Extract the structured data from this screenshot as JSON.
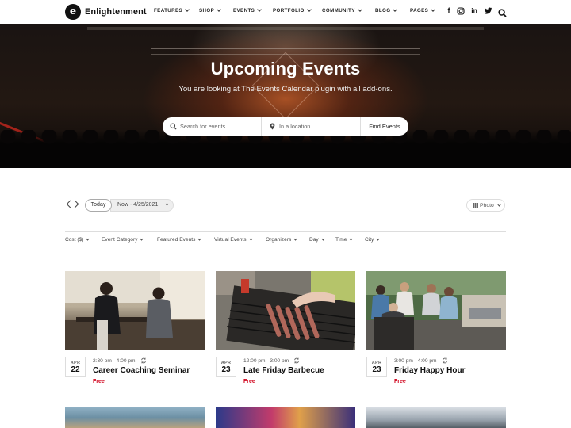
{
  "header": {
    "logo_letter": "e",
    "logo_text": "Enlightenment",
    "nav": [
      "FEATURES",
      "SHOP",
      "EVENTS",
      "PORTFOLIO",
      "COMMUNITY",
      "BLOG",
      "PAGES"
    ],
    "social": [
      "f",
      "instagram",
      "in",
      "twitter"
    ]
  },
  "hero": {
    "title": "Upcoming Events",
    "subtitle": "You are looking at The Events Calendar plugin with all add-ons.",
    "search_placeholder": "Search for events",
    "location_placeholder": "In a location",
    "find_button": "Find Events"
  },
  "controls": {
    "today": "Today",
    "date_range": "Now - 4/25/2021",
    "view": "Photo"
  },
  "filters": [
    "Cost ($)",
    "Event Category",
    "Featured Events",
    "Virtual Events",
    "Organizers",
    "Day",
    "Time",
    "City"
  ],
  "events": [
    {
      "month": "APR",
      "day": "22",
      "time": "2:30 pm - 4:00 pm",
      "title": "Career Coaching Seminar",
      "price": "Free"
    },
    {
      "month": "APR",
      "day": "23",
      "time": "12:00 pm - 3:00 pm",
      "title": "Late Friday Barbecue",
      "price": "Free"
    },
    {
      "month": "APR",
      "day": "23",
      "time": "3:00 pm - 4:00 pm",
      "title": "Friday Happy Hour",
      "price": "Free"
    }
  ],
  "colors": {
    "accent_price": "#d0021b",
    "text_dark": "#111111"
  },
  "icons": {
    "search": "search-icon",
    "location": "map-pin-icon",
    "repeat": "recurring-icon",
    "view": "grid-icon"
  }
}
